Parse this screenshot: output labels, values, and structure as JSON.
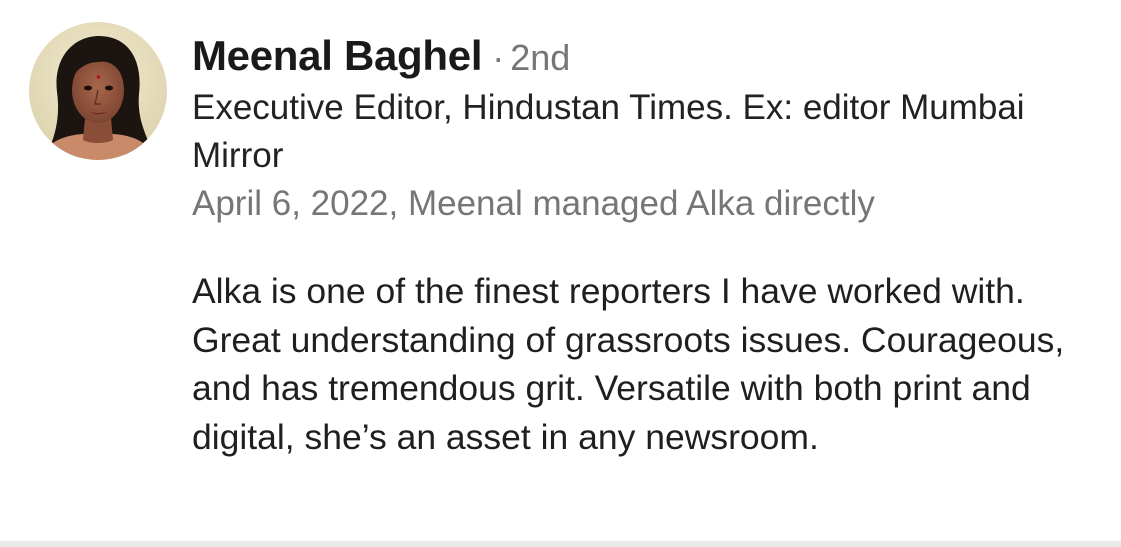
{
  "recommendation": {
    "author": {
      "name": "Meenal Baghel",
      "separator": "·",
      "degree": "2nd",
      "headline": "Executive Editor, Hindustan Times. Ex: editor Mumbai Mirror",
      "avatar_icon": "profile-photo"
    },
    "relationship": "April 6, 2022, Meenal managed Alka directly",
    "text": "Alka is one of the finest reporters I have worked with. Great understanding of grassroots issues. Courageous, and has tremendous grit. Versatile with both print and digital, she’s an asset in any newsroom."
  },
  "colors": {
    "name": "#1a1a1a",
    "secondary": "#767676",
    "body": "#1f1f1f",
    "divider": "#eaeaea"
  }
}
